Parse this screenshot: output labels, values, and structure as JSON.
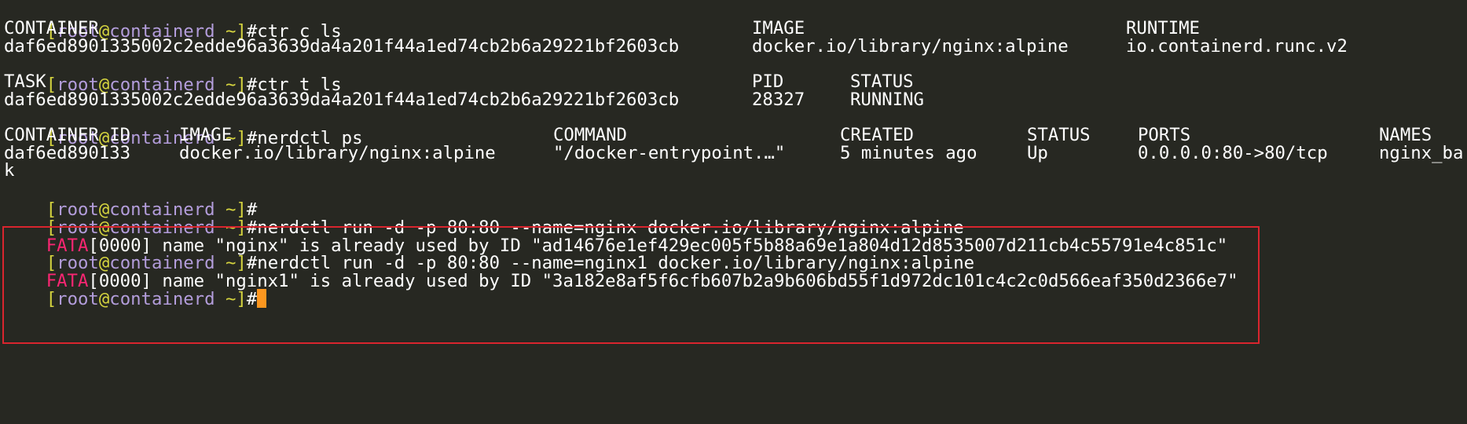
{
  "prompt": {
    "open": "[",
    "user": "root",
    "at": "@",
    "host": "containerd",
    "tilde": " ~",
    "close": "]",
    "hash": "#"
  },
  "lines": {
    "cmd1": "ctr c ls",
    "containers_header": {
      "container": "CONTAINER",
      "image": "IMAGE",
      "runtime": "RUNTIME"
    },
    "containers_row": {
      "container": "daf6ed8901335002c2edde96a3639da4a201f44a1ed74cb2b6a29221bf2603cb",
      "image": "docker.io/library/nginx:alpine",
      "runtime": "io.containerd.runc.v2"
    },
    "cmd2": "ctr t ls",
    "tasks_header": {
      "task": "TASK",
      "pid": "PID",
      "status": "STATUS"
    },
    "tasks_row": {
      "task": "daf6ed8901335002c2edde96a3639da4a201f44a1ed74cb2b6a29221bf2603cb",
      "pid": "28327",
      "status": "RUNNING"
    },
    "cmd3": "nerdctl ps",
    "ps_header": {
      "container_id": "CONTAINER ID",
      "image": "IMAGE",
      "command": "COMMAND",
      "created": "CREATED",
      "status": "STATUS",
      "ports": "PORTS",
      "names": "NAMES"
    },
    "ps_row": {
      "container_id": "daf6ed890133",
      "image": "docker.io/library/nginx:alpine",
      "command": "\"/docker-entrypoint.…\"",
      "created": "5 minutes ago",
      "status": "Up",
      "ports": "0.0.0.0:80->80/tcp",
      "names": "nginx_ba"
    },
    "ps_wrap": "k",
    "cmd4": "",
    "cmd5": "nerdctl run -d -p 80:80 --name=nginx docker.io/library/nginx:alpine",
    "err1": {
      "level": "FATA",
      "text": "[0000] name \"nginx\" is already used by ID \"ad14676e1ef429ec005f5b88a69e1a804d12d8535007d211cb4c55791e4c851c\""
    },
    "cmd6": "nerdctl run -d -p 80:80 --name=nginx1 docker.io/library/nginx:alpine",
    "err2": {
      "level": "FATA",
      "text": "[0000] name \"nginx1\" is already used by ID \"3a182e8af5f6cfb607b2a9b606bd55f1d972dc101c4c2c0d566eaf350d2366e7\""
    }
  },
  "colors": {
    "background": "#272822",
    "foreground": "#ffffff",
    "prompt_yellow": "#d5d43f",
    "prompt_purple": "#b39ddb",
    "error_red": "#f92672",
    "cursor_orange": "#fd971f",
    "highlight_border": "#d9252e"
  }
}
